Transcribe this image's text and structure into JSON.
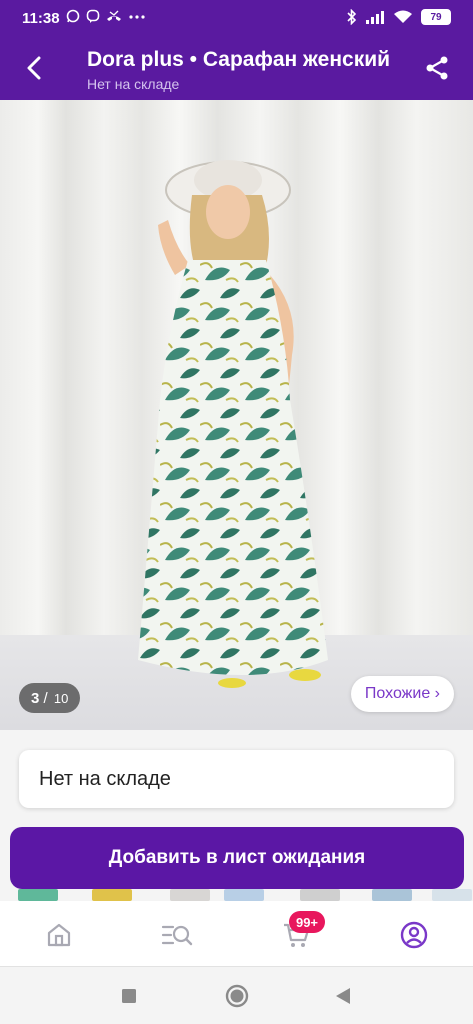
{
  "status_bar": {
    "time": "11:38",
    "left_icons": [
      "whatsapp-icon",
      "viber-icon",
      "missed-call-icon",
      "more-dots-icon"
    ],
    "right_icons": [
      "bluetooth-icon",
      "signal-icon",
      "wifi-icon"
    ],
    "battery": "79"
  },
  "header": {
    "title": "Dora plus • Сарафан женский",
    "subtitle": "Нет на складе",
    "back_icon": "back-arrow-icon",
    "share_icon": "share-icon"
  },
  "gallery": {
    "current": "3",
    "separator": "/",
    "total": "10",
    "similar_label": "Похожие ›"
  },
  "stock": {
    "label": "Нет на складе"
  },
  "actions": {
    "waitlist_label": "Добавить в лист ожидания"
  },
  "bottom_nav": {
    "items": [
      {
        "icon": "home-icon"
      },
      {
        "icon": "catalog-search-icon"
      },
      {
        "icon": "cart-icon",
        "badge": "99+"
      },
      {
        "icon": "profile-icon"
      }
    ]
  },
  "colors": {
    "brand": "#5a1aa0",
    "button": "#5b17a5",
    "badge": "#e8175d",
    "accent_link": "#7a38c8"
  }
}
